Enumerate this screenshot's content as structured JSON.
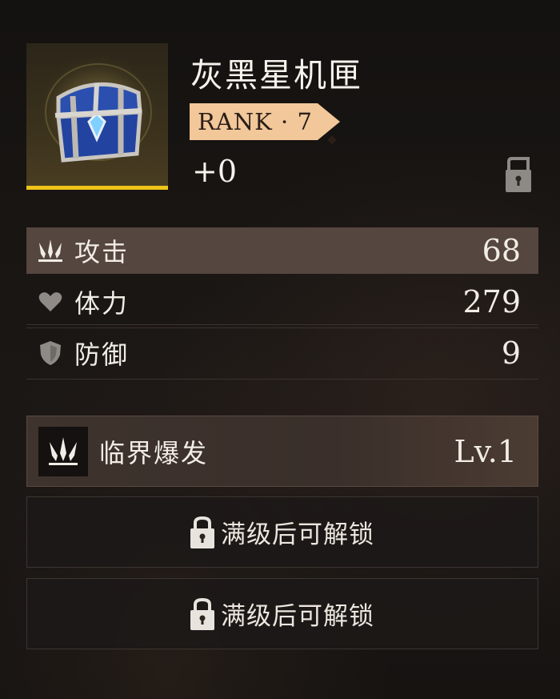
{
  "item": {
    "name": "灰黑星机匣",
    "rank_label": "RANK · 7",
    "enhance_level": "+0",
    "rarity_color": "#f0c419",
    "image_icon": "treasure-chest-icon",
    "lock_icon": "unlocked-padlock-icon"
  },
  "stats": [
    {
      "icon": "triple-blade-icon",
      "label": "攻击",
      "value": "68"
    },
    {
      "icon": "heart-icon",
      "label": "体力",
      "value": "279"
    },
    {
      "icon": "shield-icon",
      "label": "防御",
      "value": "9"
    }
  ],
  "skill": {
    "icon": "triple-blade-icon",
    "name": "临界爆发",
    "level": "Lv.1"
  },
  "locked_slots": [
    {
      "icon": "padlock-icon",
      "text": "满级后可解锁"
    },
    {
      "icon": "padlock-icon",
      "text": "满级后可解锁"
    }
  ],
  "colors": {
    "rank_badge": "#f2c79a",
    "highlight_row": "#55463f",
    "background": "#161311"
  }
}
